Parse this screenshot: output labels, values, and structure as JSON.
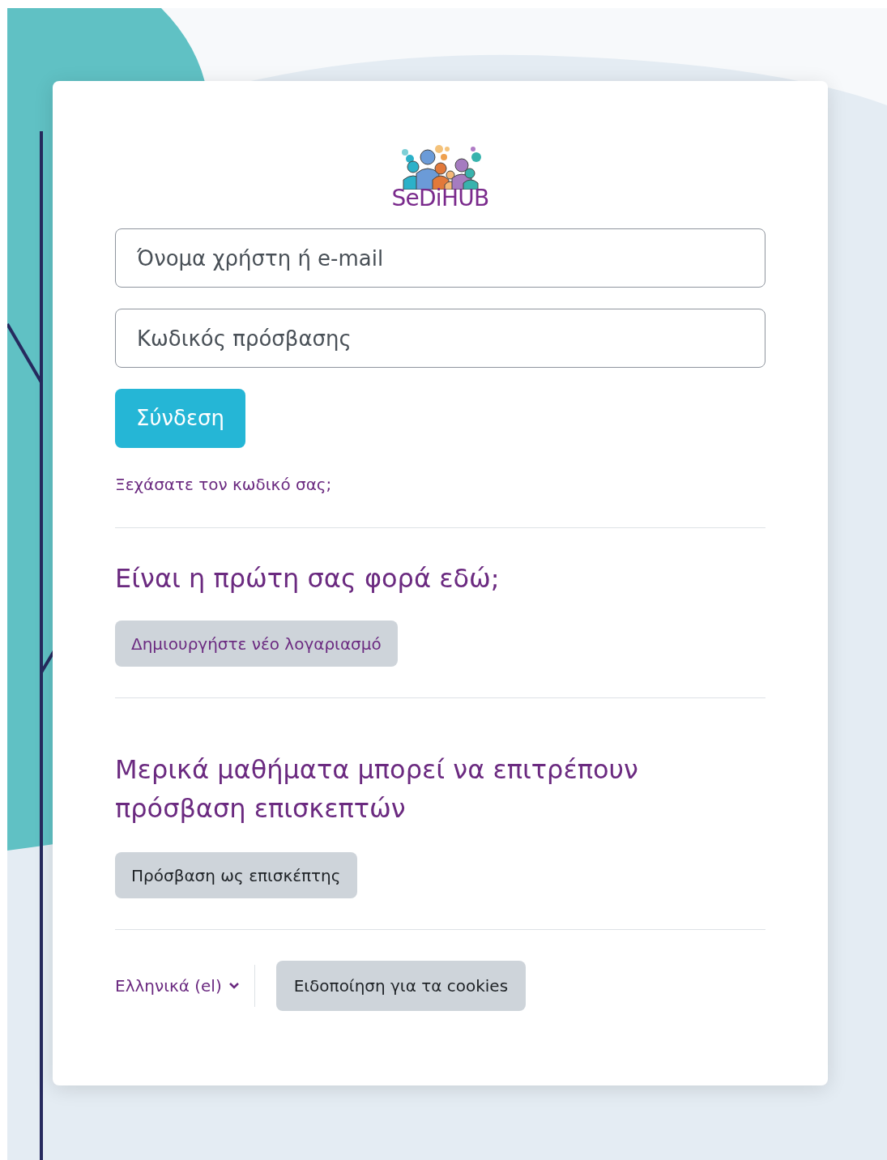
{
  "logo": {
    "text": "SeDiHUB"
  },
  "login_form": {
    "username": {
      "placeholder": "Όνομα χρήστη ή e-mail"
    },
    "password": {
      "placeholder": "Κωδικός πρόσβασης"
    },
    "submit": "Σύνδεση",
    "forgot_link": "Ξεχάσατε τον κωδικό σας;"
  },
  "signup": {
    "heading": "Είναι η πρώτη σας φορά εδώ;",
    "button": "Δημιουργήστε νέο λογαριασμό"
  },
  "guest": {
    "heading": "Μερικά μαθήματα μπορεί να επιτρέπουν πρόσβαση επισκεπτών",
    "button": "Πρόσβαση ως επισκέπτης"
  },
  "footer": {
    "language": "Ελληνικά (el)",
    "cookies_button": "Ειδοποίηση για τα cookies"
  }
}
